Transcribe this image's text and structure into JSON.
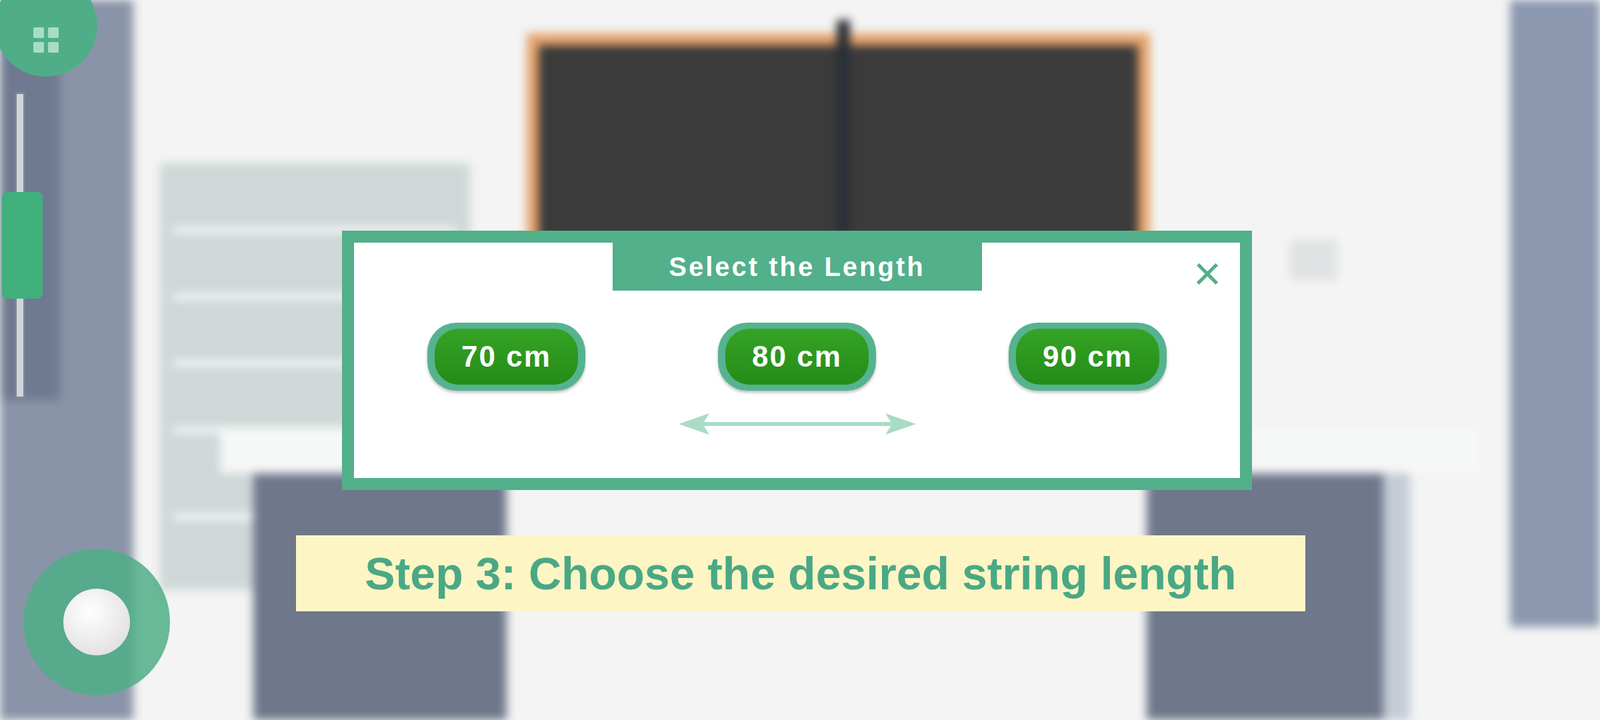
{
  "dialog": {
    "title": "Select the Length",
    "close": "×",
    "options": [
      {
        "label": "70 cm",
        "selected": false
      },
      {
        "label": "80 cm",
        "selected": false
      },
      {
        "label": "90 cm",
        "selected": false
      }
    ]
  },
  "instruction": "Step 3: Choose the desired string length",
  "side_slider": {
    "level": 0.5
  }
}
